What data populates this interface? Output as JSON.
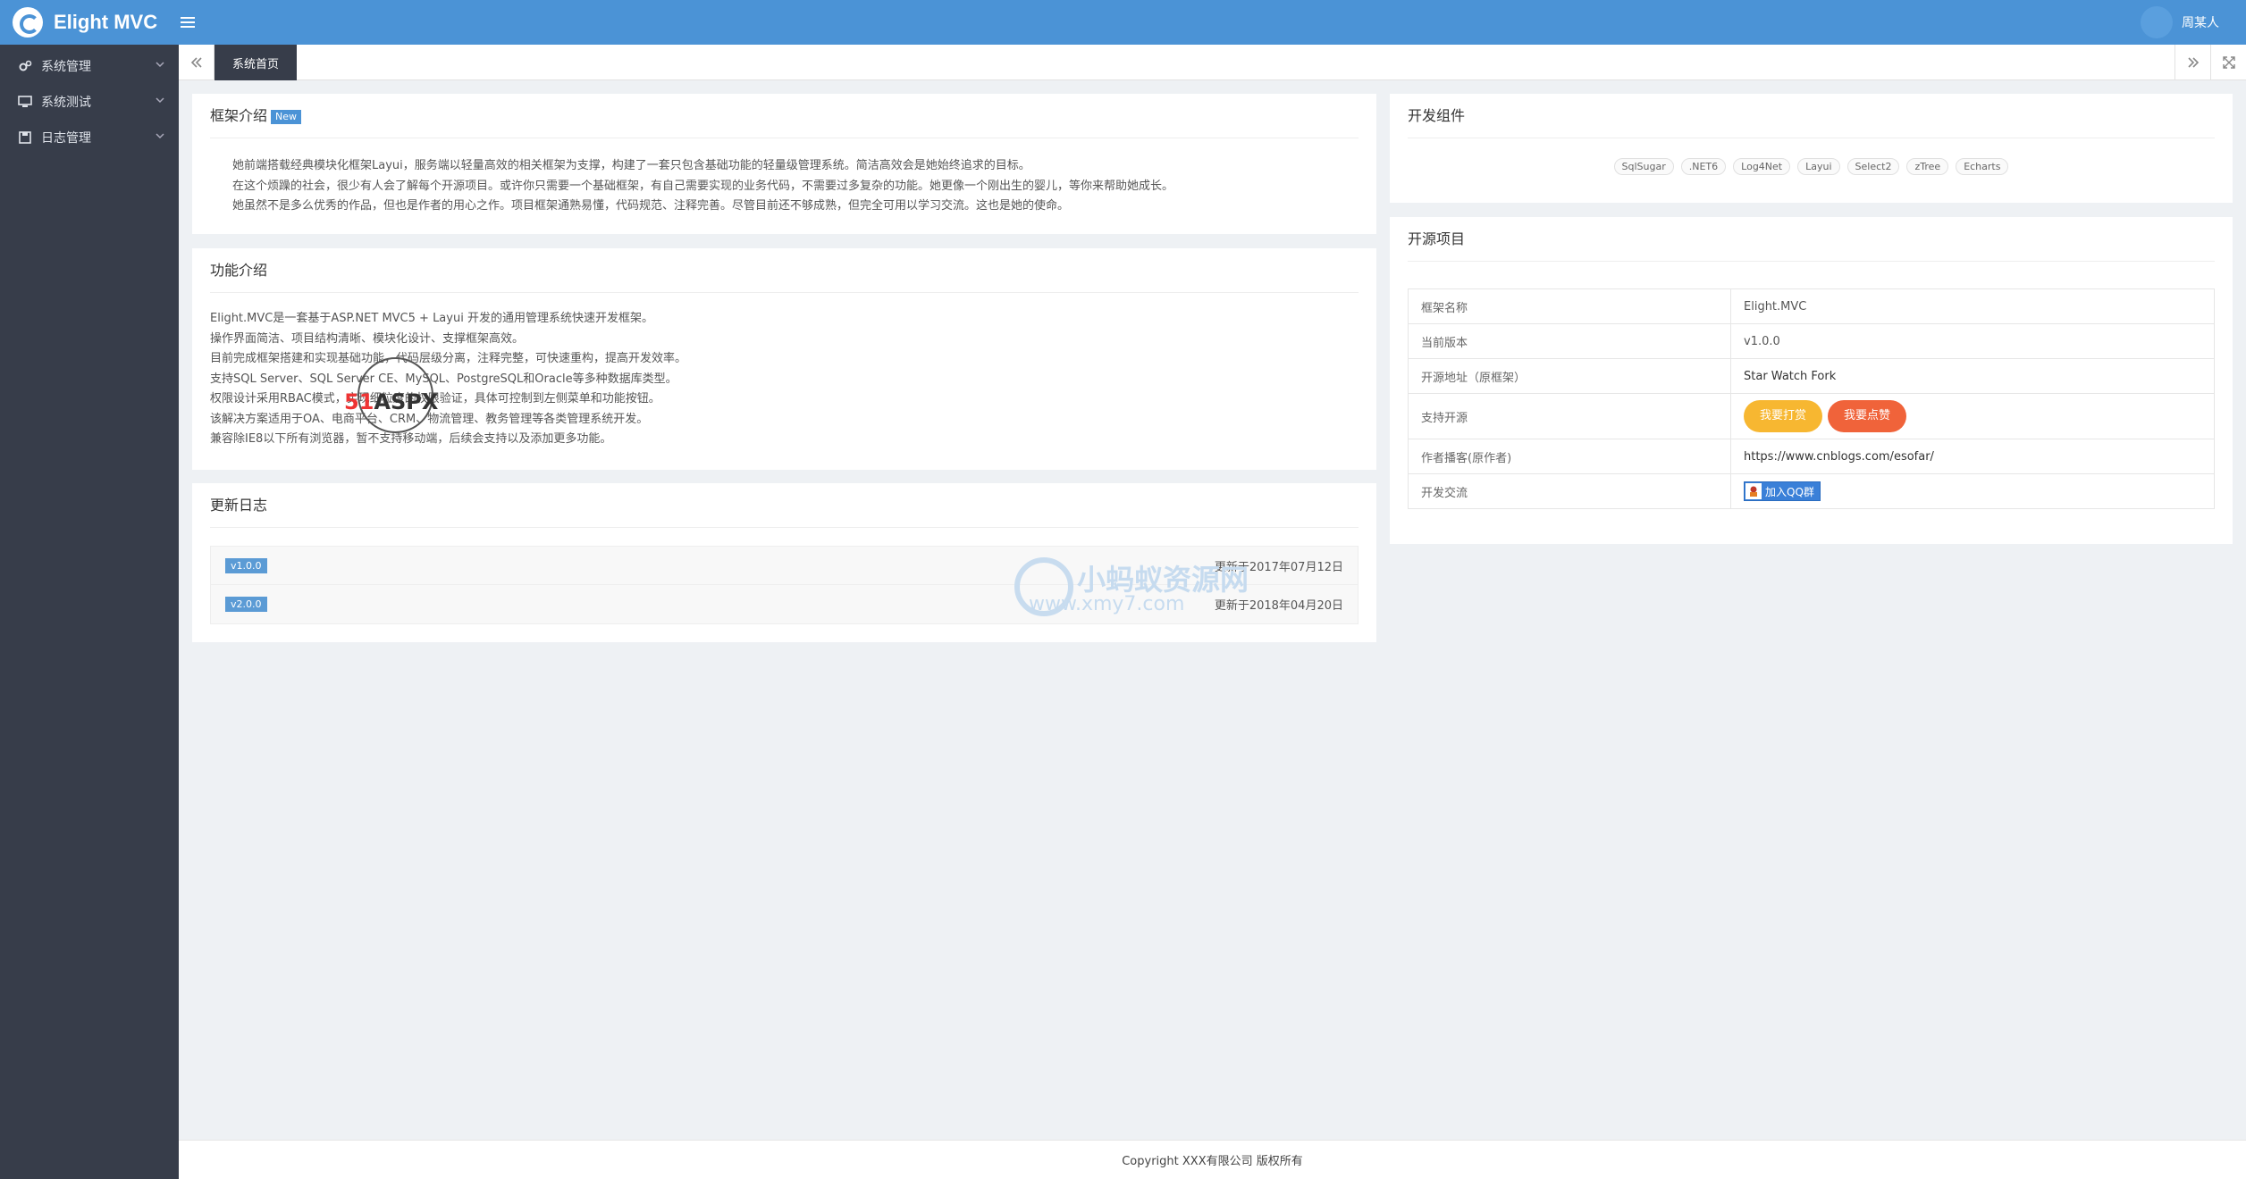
{
  "header": {
    "brand": "Elight MVC",
    "user_name": "周某人"
  },
  "sidebar": {
    "items": [
      {
        "label": "系统管理",
        "icon": "cogs-icon"
      },
      {
        "label": "系统测试",
        "icon": "monitor-icon"
      },
      {
        "label": "日志管理",
        "icon": "save-icon"
      }
    ]
  },
  "tabs": {
    "active": "系统首页"
  },
  "framework_intro": {
    "title": "框架介绍",
    "badge": "New",
    "lines": [
      "她前端搭载经典模块化框架Layui，服务端以轻量高效的相关框架为支撑，构建了一套只包含基础功能的轻量级管理系统。简洁高效会是她始终追求的目标。",
      "在这个烦躁的社会，很少有人会了解每个开源项目。或许你只需要一个基础框架，有自己需要实现的业务代码，不需要过多复杂的功能。她更像一个刚出生的婴儿，等你来帮助她成长。",
      "她虽然不是多么优秀的作品，但也是作者的用心之作。项目框架通熟易懂，代码规范、注释完善。尽管目前还不够成熟，但完全可用以学习交流。这也是她的使命。"
    ]
  },
  "features": {
    "title": "功能介绍",
    "lines": [
      "Elight.MVC是一套基于ASP.NET MVC5 + Layui 开发的通用管理系统快速开发框架。",
      "操作界面简洁、项目结构清晰、模块化设计、支撑框架高效。",
      "目前完成框架搭建和实现基础功能，代码层级分离，注释完整，可快速重构，提高开发效率。",
      "支持SQL Server、SQL Server CE、MySQL、PostgreSQL和Oracle等多种数据库类型。",
      "权限设计采用RBAC模式，实现细粒度的权限验证，具体可控制到左侧菜单和功能按钮。",
      "该解决方案适用于OA、电商平台、CRM、物流管理、教务管理等各类管理系统开发。",
      "兼容除IE8以下所有浏览器，暂不支持移动端，后续会支持以及添加更多功能。"
    ]
  },
  "changelog": {
    "title": "更新日志",
    "entries": [
      {
        "version": "v1.0.0",
        "date": "更新于2017年07月12日"
      },
      {
        "version": "v2.0.0",
        "date": "更新于2018年04月20日"
      }
    ]
  },
  "components": {
    "title": "开发组件",
    "tags": [
      "SqlSugar",
      ".NET6",
      "Log4Net",
      "Layui",
      "Select2",
      "zTree",
      "Echarts"
    ]
  },
  "project": {
    "title": "开源项目",
    "rows": {
      "name_key": "框架名称",
      "name_val": "Elight.MVC",
      "version_key": "当前版本",
      "version_val": "v1.0.0",
      "repo_key": "开源地址（原框架）",
      "repo_val": "Star Watch Fork",
      "support_key": "支持开源",
      "btn_reward": "我要打赏",
      "btn_like": "我要点赞",
      "blog_key": "作者播客(原作者)",
      "blog_val": "https://www.cnblogs.com/esofar/",
      "chat_key": "开发交流",
      "qq_btn": "加入QQ群"
    }
  },
  "footer": {
    "text": "Copyright XXX有限公司 版权所有"
  },
  "watermarks": {
    "xmy_text": "小蚂蚁资源网",
    "xmy_url": "www.xmy7.com",
    "aspx_a": "51",
    "aspx_b": "ASPX"
  },
  "colors": {
    "header": "#4b93d6",
    "sidebar": "#373d4a",
    "btn_reward": "#f7b731",
    "btn_like": "#f0633a"
  }
}
